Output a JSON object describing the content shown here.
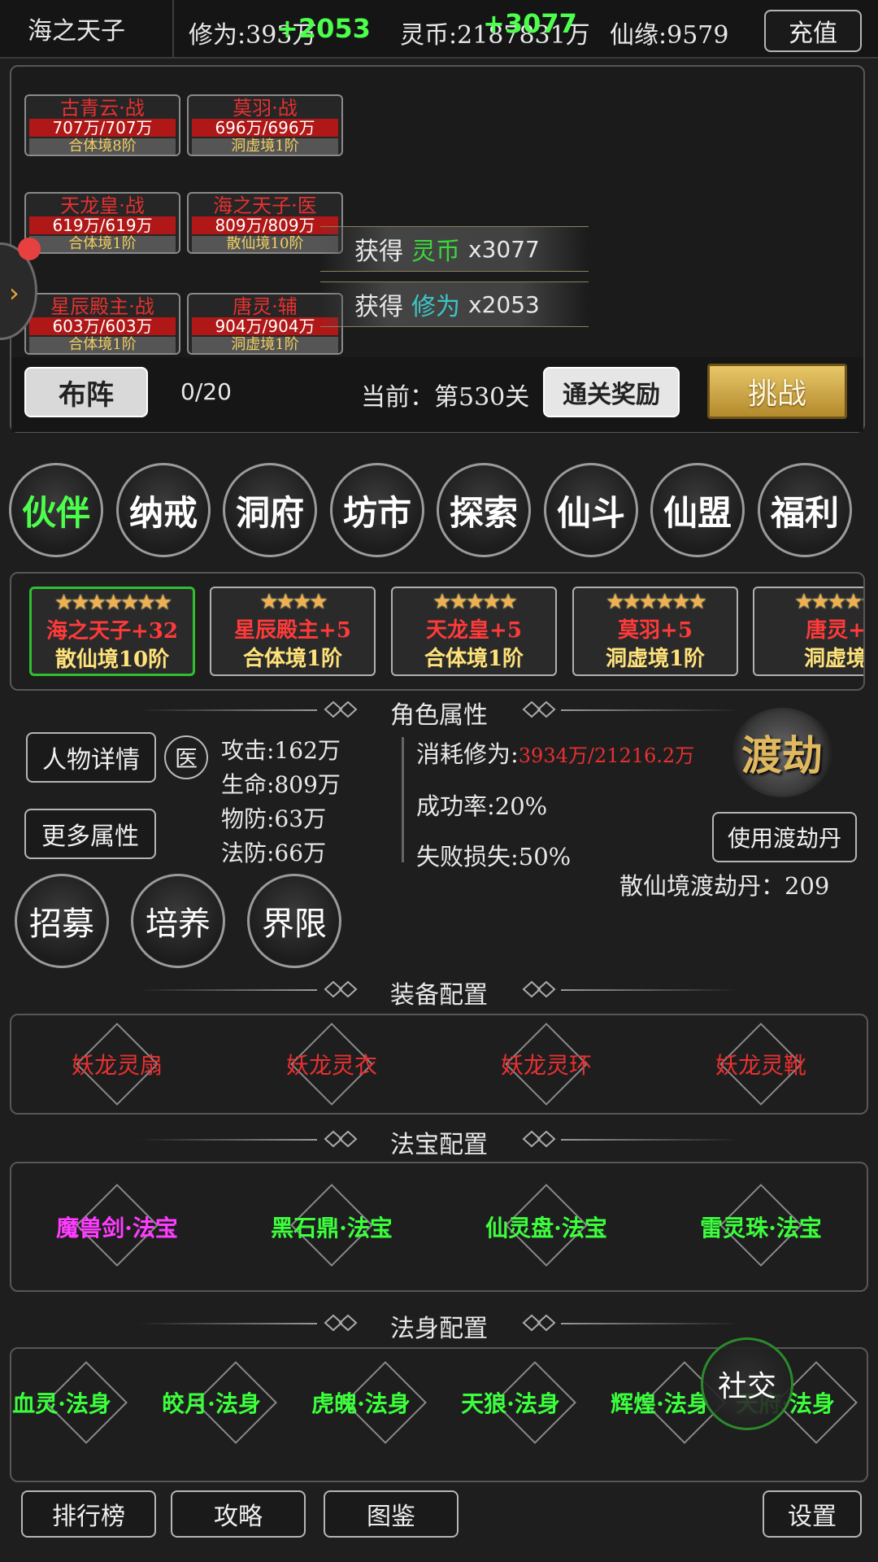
{
  "header": {
    "player_name": "海之天子",
    "cultivation_label": "修为:393万",
    "cultivation_gain": "+2053",
    "coin_label": "灵币:2187831万",
    "coin_gain": "+3077",
    "fate_label": "仙缘:9579",
    "recharge_label": "充值"
  },
  "battle": {
    "units": [
      {
        "name": "古青云·战",
        "hp": "707万/707万",
        "rank": "合体境8阶"
      },
      {
        "name": "莫羽·战",
        "hp": "696万/696万",
        "rank": "洞虚境1阶"
      },
      {
        "name": "天龙皇·战",
        "hp": "619万/619万",
        "rank": "合体境1阶"
      },
      {
        "name": "海之天子·医",
        "hp": "809万/809万",
        "rank": "散仙境10阶"
      },
      {
        "name": "星辰殿主·战",
        "hp": "603万/603万",
        "rank": "合体境1阶"
      },
      {
        "name": "唐灵·辅",
        "hp": "904万/904万",
        "rank": "洞虚境1阶"
      }
    ],
    "loot": [
      {
        "prefix": "获得",
        "item": "灵币",
        "count": "x3077",
        "color": "#39d839"
      },
      {
        "prefix": "获得",
        "item": "修为",
        "count": "x2053",
        "color": "#3cc6c6"
      }
    ],
    "formation_label": "布阵",
    "formation_count": "0/20",
    "stage_label": "当前：第530关",
    "clear_reward_label": "通关奖励",
    "challenge_label": "挑战"
  },
  "menu": [
    "伙伴",
    "纳戒",
    "洞府",
    "坊市",
    "探索",
    "仙斗",
    "仙盟",
    "福利"
  ],
  "partners": [
    {
      "stars": "★★★★★★★",
      "name": "海之天子+32",
      "rank": "散仙境10阶"
    },
    {
      "stars": "★★★★",
      "name": "星辰殿主+5",
      "rank": "合体境1阶"
    },
    {
      "stars": "★★★★★",
      "name": "天龙皇+5",
      "rank": "合体境1阶"
    },
    {
      "stars": "★★★★★★",
      "name": "莫羽+5",
      "rank": "洞虚境1阶"
    },
    {
      "stars": "★★★★★",
      "name": "唐灵+",
      "rank": "洞虚境"
    }
  ],
  "attributes": {
    "title": "角色属性",
    "detail_btn": "人物详情",
    "class_badge": "医",
    "more_btn": "更多属性",
    "attack": "攻击:162万",
    "hp": "生命:809万",
    "pdef": "物防:63万",
    "mdef": "法防:66万",
    "cost_label": "消耗修为:",
    "cost_value": "3934万/21216.2万",
    "success_rate": "成功率:20%",
    "fail_loss": "失败损失:50%",
    "tribulation_logo": "渡劫",
    "use_pill_btn": "使用渡劫丹",
    "pill_count": "散仙境渡劫丹：209",
    "actions": [
      "招募",
      "培养",
      "界限"
    ]
  },
  "equipment": {
    "title": "装备配置",
    "slots": [
      "妖龙灵扇",
      "妖龙灵衣",
      "妖龙灵环",
      "妖龙灵靴"
    ]
  },
  "treasures": {
    "title": "法宝配置",
    "slots": [
      {
        "label": "魔兽剑·法宝",
        "color": "#ff3cff"
      },
      {
        "label": "黑石鼎·法宝",
        "color": "#3cff3c"
      },
      {
        "label": "仙灵盘·法宝",
        "color": "#3cff3c"
      },
      {
        "label": "雷灵珠·法宝",
        "color": "#3cff3c"
      }
    ]
  },
  "bodies": {
    "title": "法身配置",
    "slots": [
      "血灵·法身",
      "皎月·法身",
      "虎魄·法身",
      "天狼·法身",
      "辉煌·法身",
      "天府·法身"
    ]
  },
  "social_label": "社交",
  "footer": {
    "ranking": "排行榜",
    "guide": "攻略",
    "codex": "图鉴",
    "settings": "设置"
  },
  "colors": {
    "accent_green": "#4cff4c",
    "enemy_red": "#e83030",
    "rank_gold": "#ffe27a",
    "gold_button": "#d4b050"
  }
}
